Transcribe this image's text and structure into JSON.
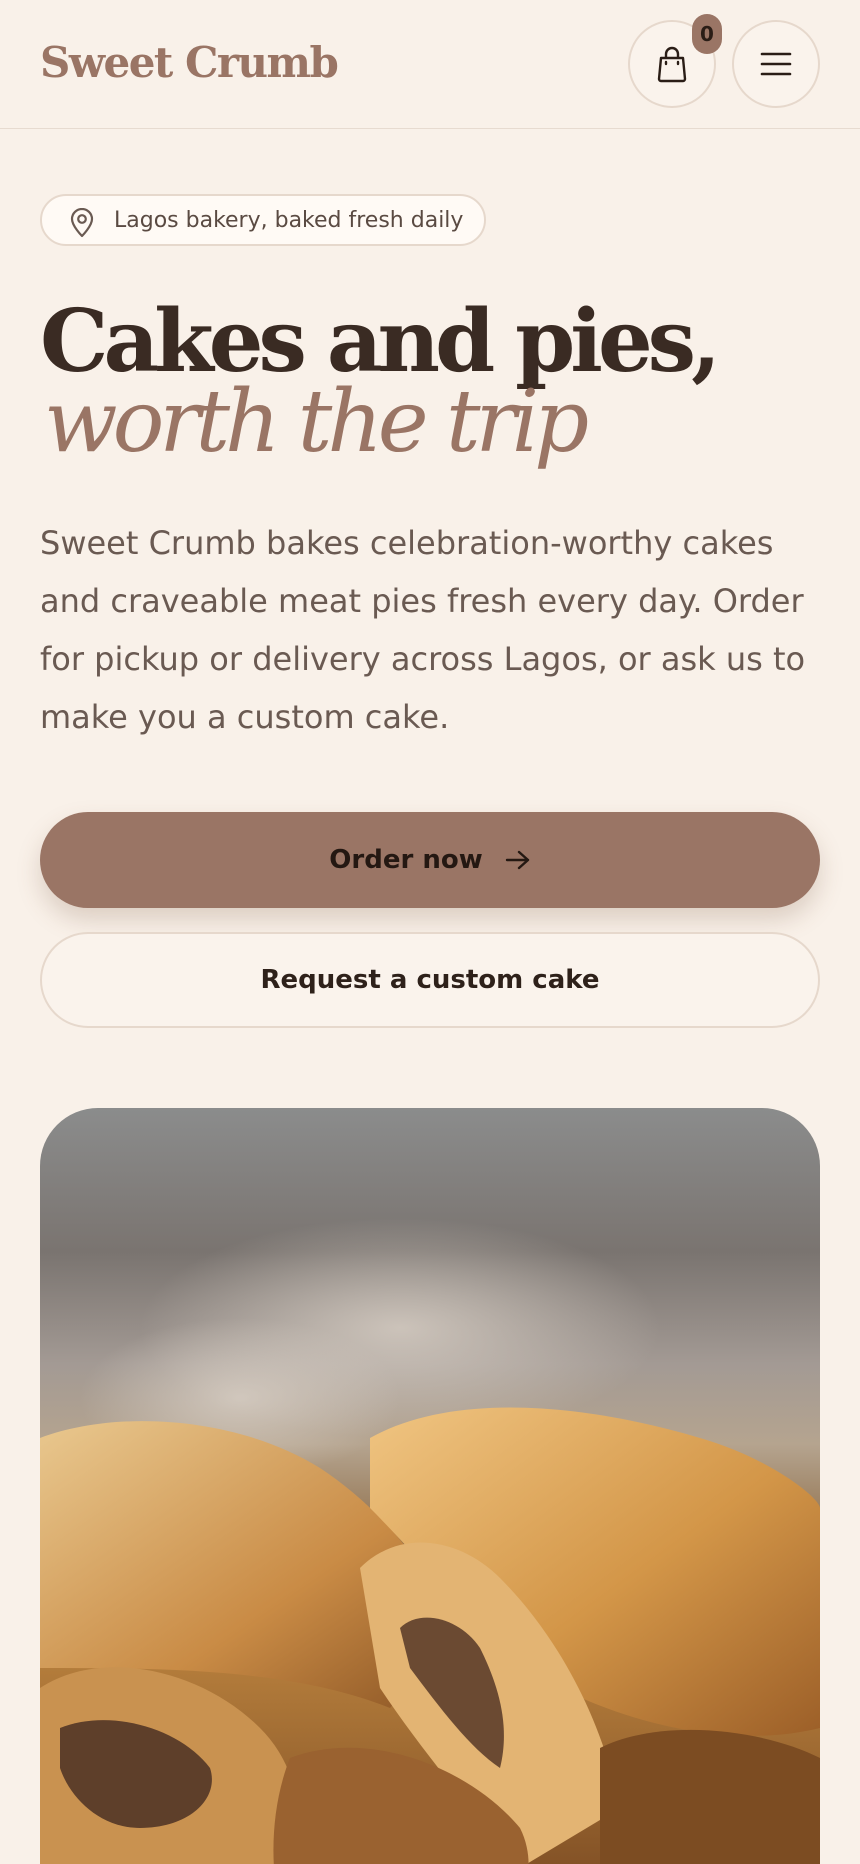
{
  "header": {
    "logo": "Sweet Crumb",
    "cart_count": "0",
    "cart_icon": "shopping-bag-icon",
    "menu_icon": "hamburger-menu-icon"
  },
  "hero": {
    "location_pill": "Lagos bakery, baked fresh daily",
    "location_icon": "map-pin-icon",
    "title": "Cakes and pies,",
    "subtitle": "worth the trip",
    "intro": "Sweet Crumb bakes celebration-worthy cakes and craveable meat pies fresh every day. Order for pickup or delivery across Lagos, or ask us to make you a custom cake.",
    "primary_cta": "Order now",
    "secondary_cta": "Request a custom cake"
  },
  "colors": {
    "accent": "#9a7565",
    "background": "#f9f1e9",
    "text_dark": "#3a2b23"
  }
}
